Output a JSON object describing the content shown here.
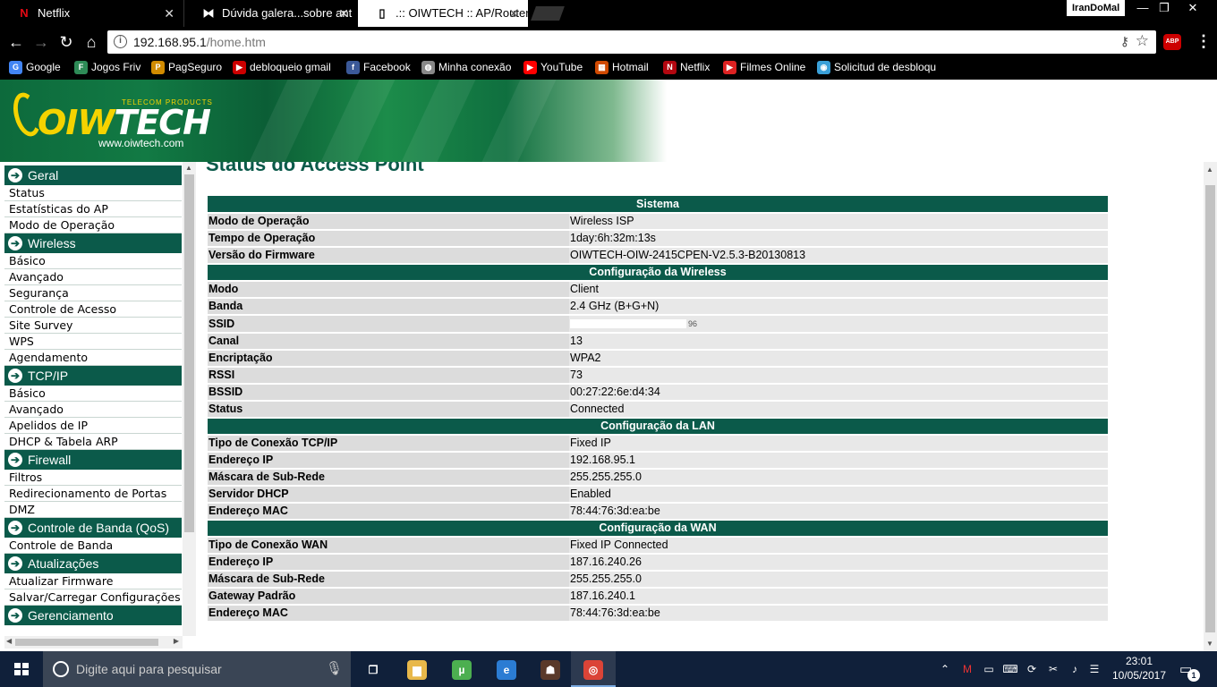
{
  "browser": {
    "tabs": [
      {
        "title": "Netflix",
        "icon": "N"
      },
      {
        "title": "Dúvida galera...sobre ant",
        "icon": "⧓"
      },
      {
        "title": ".:: OIWTECH :: AP/Router",
        "icon": "▯"
      }
    ],
    "profile": "IranDoMal",
    "window_controls": {
      "minimize": "—",
      "restore": "❐",
      "close": "✕"
    },
    "address": {
      "host": "192.168.95.1",
      "path": "/home.htm",
      "info_glyph": "i"
    },
    "abp_label": "ABP",
    "bookmarks": [
      {
        "label": "Google",
        "icon": "G",
        "color": "#4285f4"
      },
      {
        "label": "Jogos Friv",
        "icon": "F",
        "color": "#2e8b57"
      },
      {
        "label": "PagSeguro",
        "icon": "P",
        "color": "#d18b00"
      },
      {
        "label": "debloqueio gmail",
        "icon": "▶",
        "color": "#cc0000"
      },
      {
        "label": "Facebook",
        "icon": "f",
        "color": "#3b5998"
      },
      {
        "label": "Minha conexão",
        "icon": "◍",
        "color": "#888888"
      },
      {
        "label": "YouTube",
        "icon": "▶",
        "color": "#ff0000"
      },
      {
        "label": "Hotmail",
        "icon": "▦",
        "color": "#d04a02"
      },
      {
        "label": "Netflix",
        "icon": "N",
        "color": "#b20710"
      },
      {
        "label": "Filmes Online",
        "icon": "▶",
        "color": "#dd2222"
      },
      {
        "label": "Solicitud de desbloqu",
        "icon": "◉",
        "color": "#3aa0d8"
      }
    ]
  },
  "banner": {
    "brand_prefix": "OIW",
    "brand_suffix": "TECH",
    "tagline": "TELECOM PRODUCTS",
    "url": "www.oiwtech.com"
  },
  "menu": [
    {
      "heading": "Geral",
      "items": [
        "Status",
        "Estatísticas do AP",
        "Modo de Operação"
      ]
    },
    {
      "heading": "Wireless",
      "items": [
        "Básico",
        "Avançado",
        "Segurança",
        "Controle de Acesso",
        "Site Survey",
        "WPS",
        "Agendamento"
      ]
    },
    {
      "heading": "TCP/IP",
      "items": [
        "Básico",
        "Avançado",
        "Apelidos de IP",
        "DHCP & Tabela ARP"
      ]
    },
    {
      "heading": "Firewall",
      "items": [
        "Filtros",
        "Redirecionamento de Portas",
        "DMZ"
      ]
    },
    {
      "heading": "Controle de Banda (QoS)",
      "items": [
        "Controle de Banda"
      ]
    },
    {
      "heading": "Atualizações",
      "items": [
        "Atualizar Firmware",
        "Salvar/Carregar Configurações"
      ]
    },
    {
      "heading": "Gerenciamento",
      "items": []
    }
  ],
  "page_title": "Status do Access Point",
  "sections": [
    {
      "title": "Sistema",
      "rows": [
        {
          "k": "Modo de Operação",
          "v": "Wireless ISP"
        },
        {
          "k": "Tempo de Operação",
          "v": "1day:6h:32m:13s"
        },
        {
          "k": "Versão do Firmware",
          "v": "OIWTECH-OIW-2415CPEN-V2.5.3-B20130813"
        }
      ]
    },
    {
      "title": "Configuração da Wireless",
      "rows": [
        {
          "k": "Modo",
          "v": "Client"
        },
        {
          "k": "Banda",
          "v": "2.4 GHz (B+G+N)"
        },
        {
          "k": "SSID",
          "v": "96",
          "masked": true
        },
        {
          "k": "Canal",
          "v": "13"
        },
        {
          "k": "Encriptação",
          "v": "WPA2"
        },
        {
          "k": "RSSI",
          "v": "73"
        },
        {
          "k": "BSSID",
          "v": "00:27:22:6e:d4:34"
        },
        {
          "k": "Status",
          "v": "Connected"
        }
      ]
    },
    {
      "title": "Configuração da LAN",
      "rows": [
        {
          "k": "Tipo de Conexão TCP/IP",
          "v": "Fixed IP"
        },
        {
          "k": "Endereço IP",
          "v": "192.168.95.1"
        },
        {
          "k": "Máscara de Sub-Rede",
          "v": "255.255.255.0"
        },
        {
          "k": "Servidor DHCP",
          "v": "Enabled"
        },
        {
          "k": "Endereço MAC",
          "v": "78:44:76:3d:ea:be"
        }
      ]
    },
    {
      "title": "Configuração da WAN",
      "rows": [
        {
          "k": "Tipo de Conexão WAN",
          "v": "Fixed IP Connected"
        },
        {
          "k": "Endereço IP",
          "v": "187.16.240.26"
        },
        {
          "k": "Máscara de Sub-Rede",
          "v": "255.255.255.0"
        },
        {
          "k": "Gateway Padrão",
          "v": "187.16.240.1"
        },
        {
          "k": "Endereço MAC",
          "v": "78:44:76:3d:ea:be"
        }
      ]
    }
  ],
  "taskbar": {
    "search_placeholder": "Digite aqui para pesquisar",
    "pinned": [
      {
        "name": "task-view-icon",
        "glyph": "❐",
        "color": "transparent"
      },
      {
        "name": "file-explorer-icon",
        "glyph": "▆",
        "color": "#e8b84a"
      },
      {
        "name": "utorrent-icon",
        "glyph": "µ",
        "color": "#4caf50"
      },
      {
        "name": "edge-icon",
        "glyph": "e",
        "color": "#2b7cd3"
      },
      {
        "name": "game-icon",
        "glyph": "☗",
        "color": "#5a3a2a"
      },
      {
        "name": "chrome-icon",
        "glyph": "◎",
        "color": "#db4437"
      }
    ],
    "time": "23:01",
    "date": "10/05/2017",
    "notifications": "1"
  }
}
